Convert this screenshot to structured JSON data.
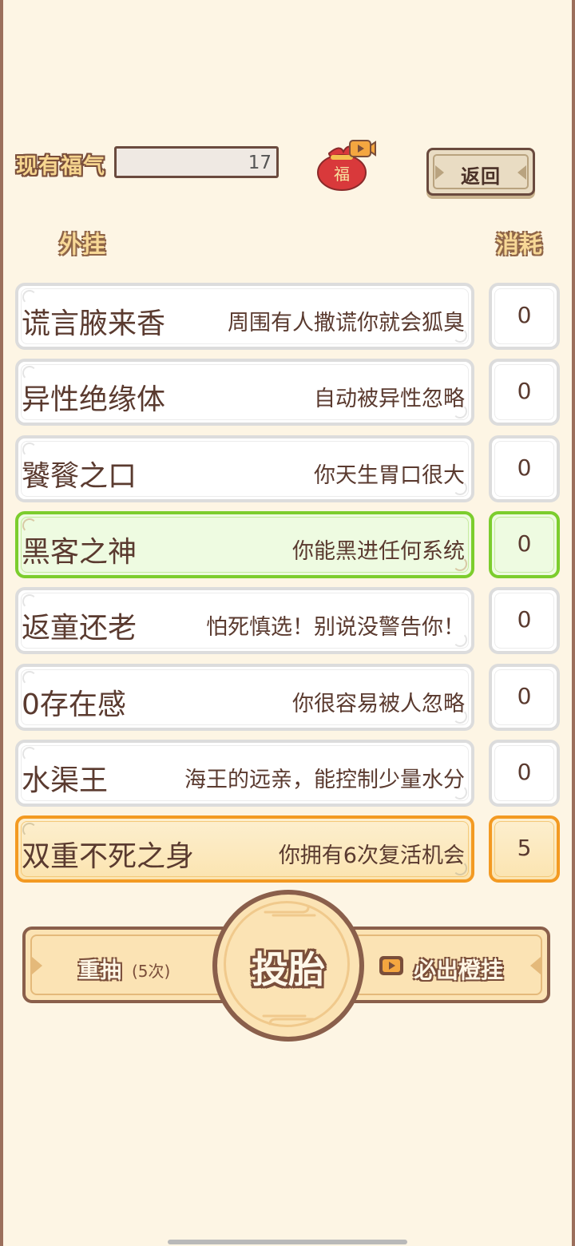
{
  "header": {
    "fortune_label": "现有福气",
    "fortune_value": "17",
    "bag_char": "福",
    "back_label": "返回"
  },
  "columns": {
    "cheat": "外挂",
    "cost": "消耗"
  },
  "cheats": [
    {
      "name": "谎言腋来香",
      "desc": "周围有人撒谎你就会狐臭",
      "cost": "0",
      "style": "normal"
    },
    {
      "name": "异性绝缘体",
      "desc": "自动被异性忽略",
      "cost": "0",
      "style": "normal"
    },
    {
      "name": "饕餮之口",
      "desc": "你天生胃口很大",
      "cost": "0",
      "style": "normal"
    },
    {
      "name": "黑客之神",
      "desc": "你能黑进任何系统",
      "cost": "0",
      "style": "green"
    },
    {
      "name": "返童还老",
      "desc": "怕死慎选！别说没警告你！",
      "cost": "0",
      "style": "normal"
    },
    {
      "name": "0存在感",
      "desc": "你很容易被人忽略",
      "cost": "0",
      "style": "normal"
    },
    {
      "name": "水渠王",
      "desc": "海王的远亲，能控制少量水分",
      "cost": "0",
      "style": "normal"
    },
    {
      "name": "双重不死之身",
      "desc": "你拥有6次复活机会",
      "cost": "5",
      "style": "orange"
    }
  ],
  "actions": {
    "reroll_label": "重抽",
    "reroll_count": "(5次)",
    "reincarnate_label": "投胎",
    "orange_label": "必出橙挂"
  },
  "colors": {
    "background": "#fdf5e4",
    "accent_brown": "#8a5f4b",
    "green_border": "#7ccd2d",
    "orange_border": "#f39a22"
  }
}
